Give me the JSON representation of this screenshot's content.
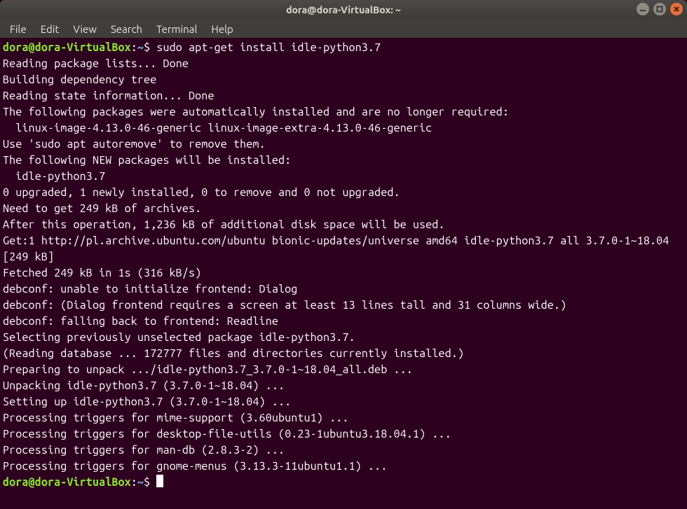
{
  "titlebar": {
    "title": "dora@dora-VirtualBox: ~"
  },
  "menubar": {
    "items": [
      {
        "label": "File"
      },
      {
        "label": "Edit"
      },
      {
        "label": "View"
      },
      {
        "label": "Search"
      },
      {
        "label": "Terminal"
      },
      {
        "label": "Help"
      }
    ]
  },
  "prompt": {
    "user_host": "dora@dora-VirtualBox",
    "sep": ":",
    "cwd": "~",
    "dollar": "$"
  },
  "command": "sudo apt-get install idle-python3.7",
  "lines": [
    "Reading package lists... Done",
    "Building dependency tree       ",
    "Reading state information... Done",
    "The following packages were automatically installed and are no longer required:",
    "  linux-image-4.13.0-46-generic linux-image-extra-4.13.0-46-generic",
    "Use 'sudo apt autoremove' to remove them.",
    "The following NEW packages will be installed:",
    "  idle-python3.7",
    "0 upgraded, 1 newly installed, 0 to remove and 0 not upgraded.",
    "Need to get 249 kB of archives.",
    "After this operation, 1,236 kB of additional disk space will be used.",
    "Get:1 http://pl.archive.ubuntu.com/ubuntu bionic-updates/universe amd64 idle-python3.7 all 3.7.0-1~18.04 [249 kB]",
    "Fetched 249 kB in 1s (316 kB/s)",
    "debconf: unable to initialize frontend: Dialog",
    "debconf: (Dialog frontend requires a screen at least 13 lines tall and 31 columns wide.)",
    "debconf: falling back to frontend: Readline",
    "Selecting previously unselected package idle-python3.7.",
    "(Reading database ... 172777 files and directories currently installed.)",
    "Preparing to unpack .../idle-python3.7_3.7.0-1~18.04_all.deb ...",
    "Unpacking idle-python3.7 (3.7.0-1~18.04) ...",
    "Setting up idle-python3.7 (3.7.0-1~18.04) ...",
    "Processing triggers for mime-support (3.60ubuntu1) ...",
    "Processing triggers for desktop-file-utils (0.23-1ubuntu3.18.04.1) ...",
    "Processing triggers for man-db (2.8.3-2) ...",
    "Processing triggers for gnome-menus (3.13.3-11ubuntu1.1) ..."
  ]
}
